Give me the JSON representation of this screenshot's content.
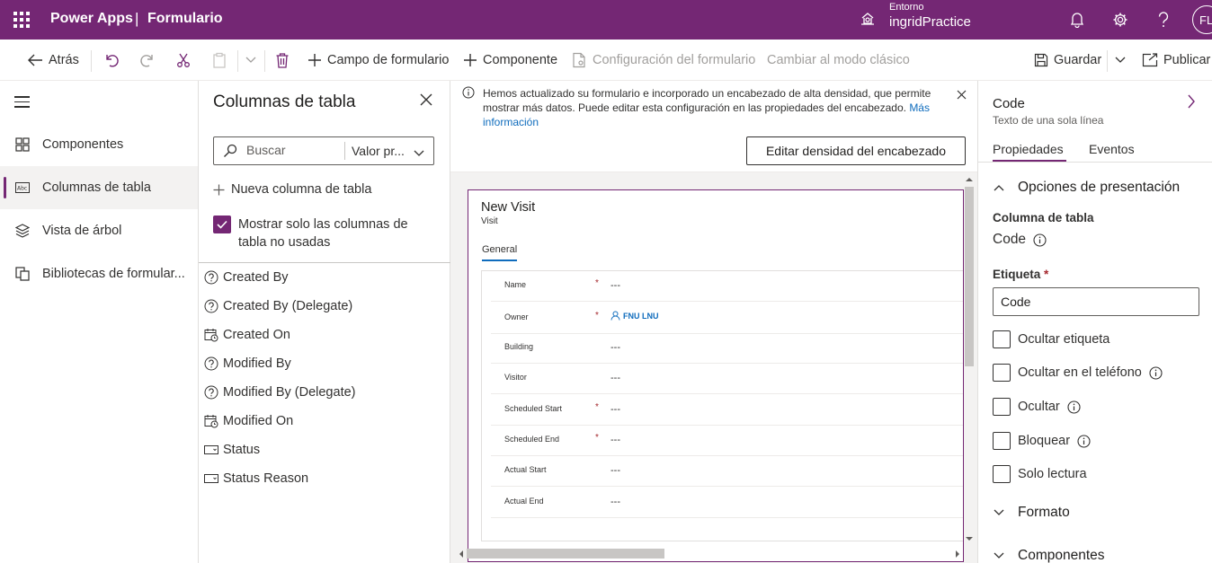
{
  "topbar": {
    "app_name": "Power Apps",
    "separator": "|",
    "page_name": "Formulario",
    "env_label": "Entorno",
    "env_value": "ingridPractice",
    "avatar_initials": "FL"
  },
  "cmdbar": {
    "back": "Atrás",
    "form_field": "Campo de formulario",
    "component": "Componente",
    "form_settings": "Configuración del formulario",
    "classic_mode": "Cambiar al modo clásico",
    "save": "Guardar",
    "publish": "Publicar"
  },
  "leftnav": {
    "items": [
      {
        "label": "Componentes",
        "icon": "components-icon"
      },
      {
        "label": "Columnas de tabla",
        "icon": "table-columns-icon"
      },
      {
        "label": "Vista de árbol",
        "icon": "tree-view-icon"
      },
      {
        "label": "Bibliotecas de formular...",
        "icon": "form-libraries-icon"
      }
    ]
  },
  "columns_panel": {
    "title": "Columnas de tabla",
    "search_placeholder": "Buscar",
    "sort_value": "Valor pr...",
    "new_column": "Nueva columna de tabla",
    "show_unused": "Mostrar solo las columnas de tabla no usadas",
    "show_unused_checked": true,
    "columns": [
      {
        "label": "Created By",
        "icon": "lookup-icon"
      },
      {
        "label": "Created By (Delegate)",
        "icon": "lookup-icon"
      },
      {
        "label": "Created On",
        "icon": "calendar-icon"
      },
      {
        "label": "Modified By",
        "icon": "lookup-icon"
      },
      {
        "label": "Modified By (Delegate)",
        "icon": "lookup-icon"
      },
      {
        "label": "Modified On",
        "icon": "calendar-icon"
      },
      {
        "label": "Status",
        "icon": "option-set-icon"
      },
      {
        "label": "Status Reason",
        "icon": "option-set-icon"
      }
    ]
  },
  "banner": {
    "text": "Hemos actualizado su formulario e incorporado un encabezado de alta densidad, que permite mostrar más datos. Puede editar esta configuración en las propiedades del encabezado.",
    "link": "Más información",
    "button": "Editar densidad del encabezado"
  },
  "form": {
    "title": "New Visit",
    "subtitle": "Visit",
    "tab": "General",
    "fields": [
      {
        "label": "Name",
        "required": true,
        "value": "---"
      },
      {
        "label": "Owner",
        "required": true,
        "value": "FNU LNU",
        "lookup": true
      },
      {
        "label": "Building",
        "required": false,
        "value": "---"
      },
      {
        "label": "Visitor",
        "required": false,
        "value": "---"
      },
      {
        "label": "Scheduled Start",
        "required": true,
        "value": "---"
      },
      {
        "label": "Scheduled End",
        "required": true,
        "value": "---"
      },
      {
        "label": "Actual Start",
        "required": false,
        "value": "---"
      },
      {
        "label": "Actual End",
        "required": false,
        "value": "---"
      }
    ],
    "required_mark": "*"
  },
  "properties": {
    "title": "Code",
    "subtitle": "Texto de una sola línea",
    "tab_properties": "Propiedades",
    "tab_events": "Eventos",
    "section_display": "Opciones de presentación",
    "column_label": "Columna de tabla",
    "column_value": "Code",
    "label_label": "Etiqueta",
    "label_required": "*",
    "label_value": "Code",
    "checks": [
      {
        "label": "Ocultar etiqueta",
        "info": false
      },
      {
        "label": "Ocultar en el teléfono",
        "info": true
      },
      {
        "label": "Ocultar",
        "info": true
      },
      {
        "label": "Bloquear",
        "info": true
      },
      {
        "label": "Solo lectura",
        "info": false
      }
    ],
    "section_format": "Formato",
    "section_components": "Componentes"
  },
  "colors": {
    "brand": "#742774",
    "link": "#0f6cbd",
    "required": "#a4262c"
  }
}
